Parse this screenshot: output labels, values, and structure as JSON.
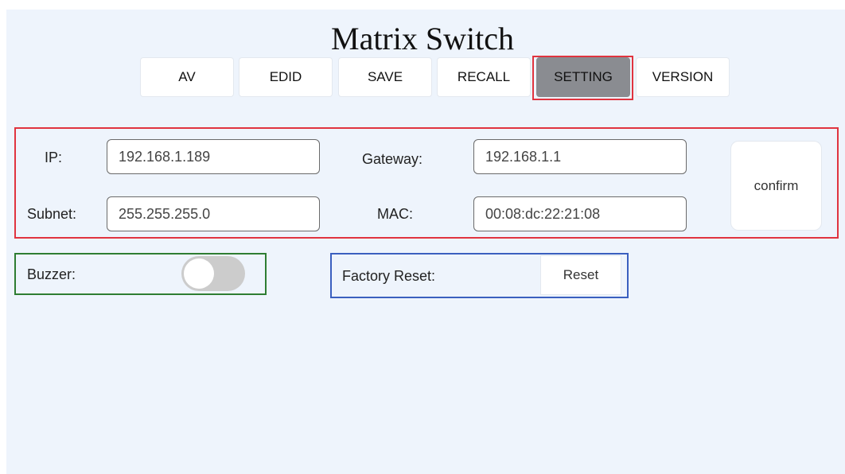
{
  "title": "Matrix Switch",
  "nav": {
    "av": "AV",
    "edid": "EDID",
    "save": "SAVE",
    "recall": "RECALL",
    "setting": "SETTING",
    "version": "VERSION",
    "active": "SETTING"
  },
  "network": {
    "ip_label": "IP:",
    "ip_value": "192.168.1.189",
    "gateway_label": "Gateway:",
    "gateway_value": "192.168.1.1",
    "subnet_label": "Subnet:",
    "subnet_value": "255.255.255.0",
    "mac_label": "MAC:",
    "mac_value": "00:08:dc:22:21:08",
    "confirm_label": "confirm"
  },
  "buzzer": {
    "label": "Buzzer:",
    "enabled": false
  },
  "factory_reset": {
    "label": "Factory Reset:",
    "button_label": "Reset"
  },
  "colors": {
    "background": "#eef4fc",
    "active_tab": "#8a8c91",
    "network_outline": "#e0343f",
    "buzzer_outline": "#2e7d32",
    "reset_outline": "#3a5fbf"
  }
}
